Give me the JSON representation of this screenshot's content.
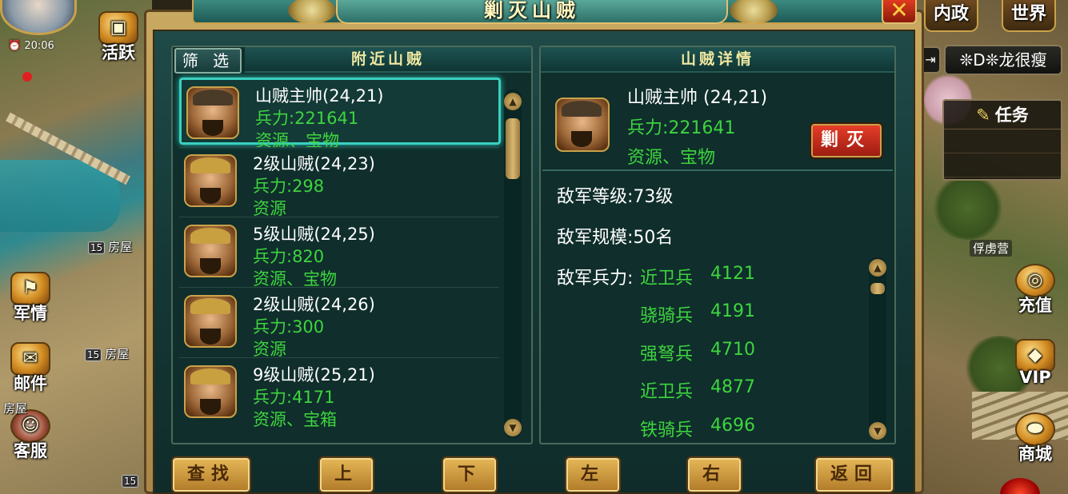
{
  "window": {
    "title": "剿灭山贼",
    "close_label": "✕"
  },
  "hud": {
    "clock": "20:06",
    "top_right_buttons": [
      "内政",
      "世界"
    ],
    "player_name": "❊D❊龙很瘦",
    "task_label": "任务",
    "left_buttons": [
      {
        "label": "活跃",
        "icon": "chest-icon"
      },
      {
        "label": "军情",
        "icon": "banner-icon"
      },
      {
        "label": "邮件",
        "icon": "scroll-icon"
      },
      {
        "label": "客服",
        "icon": "maiden-icon"
      }
    ],
    "right_buttons": [
      {
        "label": "充值",
        "icon": "coins-icon"
      },
      {
        "label": "VIP",
        "icon": "vip-card-icon"
      },
      {
        "label": "商城",
        "icon": "gold-ingot-icon"
      }
    ],
    "building_tags": [
      {
        "level": "15",
        "name": "房屋"
      },
      {
        "level": "15",
        "name": "房屋"
      },
      {
        "level": "",
        "name": "房屋"
      }
    ],
    "bottom_level": "15",
    "captive_camp": "俘虏营"
  },
  "nearby": {
    "filter_label": "筛 选",
    "header": "附近山贼",
    "items": [
      {
        "name": "山贼主帅(24,21)",
        "troops": "兵力:221641",
        "rewards": "资源、宝物",
        "selected": true
      },
      {
        "name": "2级山贼(24,23)",
        "troops": "兵力:298",
        "rewards": "资源",
        "selected": false
      },
      {
        "name": "5级山贼(24,25)",
        "troops": "兵力:820",
        "rewards": "资源、宝物",
        "selected": false
      },
      {
        "name": "2级山贼(24,26)",
        "troops": "兵力:300",
        "rewards": "资源",
        "selected": false
      },
      {
        "name": "9级山贼(25,21)",
        "troops": "兵力:4171",
        "rewards": "资源、宝箱",
        "selected": false
      }
    ]
  },
  "detail": {
    "header": "山贼详情",
    "name": "山贼主帅 (24,21)",
    "troops": "兵力:221641",
    "rewards": "资源、宝物",
    "attack_label": "剿灭",
    "enemy_level": "敌军等级:73级",
    "enemy_scale": "敌军规模:50名",
    "enemy_troops_label": "敌军兵力:",
    "units": [
      {
        "type": "近卫兵",
        "count": "4121"
      },
      {
        "type": "骁骑兵",
        "count": "4191"
      },
      {
        "type": "强弩兵",
        "count": "4710"
      },
      {
        "type": "近卫兵",
        "count": "4877"
      },
      {
        "type": "铁骑兵",
        "count": "4696"
      }
    ]
  },
  "bottom_buttons": {
    "search": "查找",
    "up": "上",
    "down": "下",
    "left": "左",
    "right": "右",
    "back": "返回"
  },
  "colors": {
    "accent_green": "#3ed43e",
    "frame_gold": "#c9a24a",
    "panel_teal": "#153836",
    "kill_red": "#e8402a"
  }
}
